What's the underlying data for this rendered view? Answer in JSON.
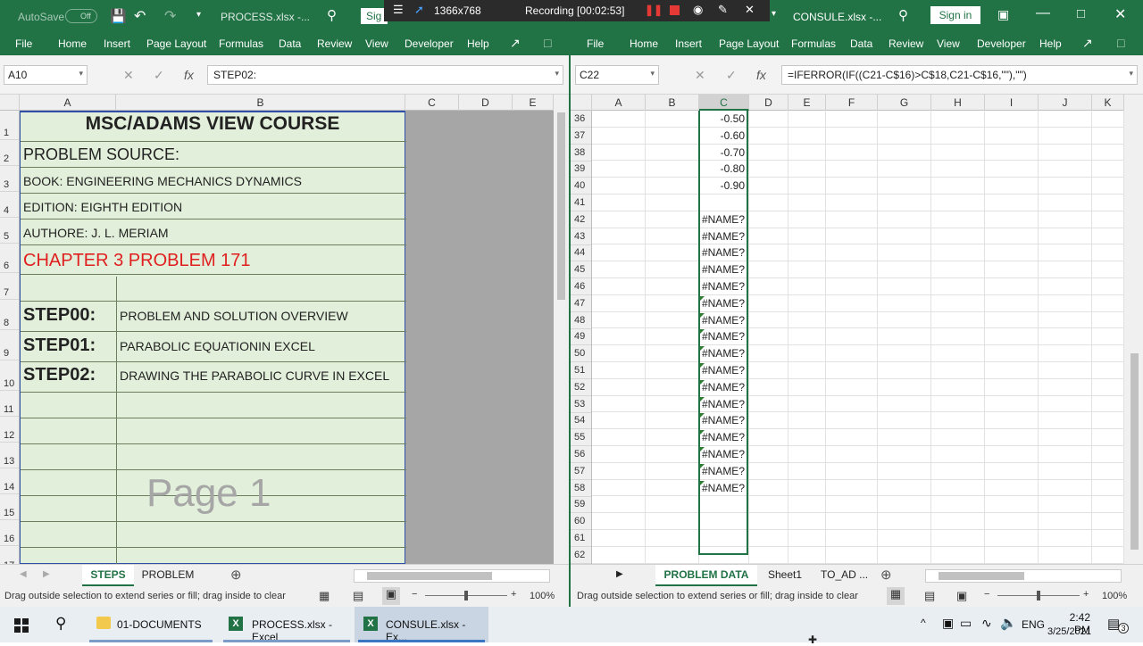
{
  "left": {
    "autosave_label": "AutoSave",
    "autosave_state": "Off",
    "title": "PROCESS.xlsx  -...",
    "signin_label": "Sig",
    "menu": [
      "File",
      "Home",
      "Insert",
      "Page Layout",
      "Formulas",
      "Data",
      "Review",
      "View",
      "Developer",
      "Help"
    ],
    "name_box": "A10",
    "formula": "STEP02:",
    "columns": [
      "A",
      "B",
      "C",
      "D",
      "E"
    ],
    "rows": [
      "1",
      "2",
      "3",
      "4",
      "5",
      "6",
      "7",
      "8",
      "9",
      "10",
      "11",
      "12",
      "13",
      "14",
      "15",
      "16",
      "17"
    ],
    "cells": {
      "title": "MSC/ADAMS VIEW COURSE",
      "source": "PROBLEM SOURCE:",
      "book": "BOOK: ENGINEERING MECHANICS DYNAMICS",
      "edition": "EDITION: EIGHTH EDITION",
      "author": "AUTHORE: J. L. MERIAM",
      "chapter": "CHAPTER 3 PROBLEM 171",
      "step00": "STEP00:",
      "step00_desc": "PROBLEM AND SOLUTION OVERVIEW",
      "step01": "STEP01:",
      "step01_desc": "PARABOLIC EQUATIONIN EXCEL",
      "step02": "STEP02:",
      "step02_desc": "DRAWING THE PARABOLIC CURVE IN EXCEL"
    },
    "watermark": "Page 1",
    "tabs": [
      "STEPS",
      "PROBLEM"
    ],
    "active_tab": "STEPS",
    "status": "Drag outside selection to extend series or fill; drag inside to clear",
    "zoom": "100%"
  },
  "recording": {
    "resolution": "1366x768",
    "label": "Recording [00:02:53]"
  },
  "right": {
    "title": "CONSULE.xlsx  -...",
    "signin_label": "Sign in",
    "menu": [
      "File",
      "Home",
      "Insert",
      "Page Layout",
      "Formulas",
      "Data",
      "Review",
      "View",
      "Developer",
      "Help"
    ],
    "name_box": "C22",
    "formula": "=IFERROR(IF((C21-C$16)>C$18,C21-C$16,\"\"),\"\")",
    "columns": [
      "A",
      "B",
      "C",
      "D",
      "E",
      "F",
      "G",
      "H",
      "I",
      "J",
      "K"
    ],
    "rows": [
      "36",
      "37",
      "38",
      "39",
      "40",
      "41",
      "42",
      "43",
      "44",
      "45",
      "46",
      "47",
      "48",
      "49",
      "50",
      "51",
      "52",
      "53",
      "54",
      "55",
      "56",
      "57",
      "58",
      "59",
      "60",
      "61",
      "62"
    ],
    "values": [
      "-0.50",
      "-0.60",
      "-0.70",
      "-0.80",
      "-0.90"
    ],
    "error_value": "#NAME?",
    "tabs": [
      "PROBLEM DATA",
      "Sheet1",
      "TO_AD ..."
    ],
    "active_tab": "PROBLEM DATA",
    "status": "Drag outside selection to extend series or fill; drag inside to clear",
    "zoom": "100%"
  },
  "taskbar": {
    "items": [
      "01-DOCUMENTS",
      "PROCESS.xlsx - Excel",
      "CONSULE.xlsx - Ex..."
    ],
    "lang": "ENG",
    "time": "2:42 PM",
    "date": "3/25/2021",
    "notif": "3"
  },
  "colors": {
    "excel_green": "#217346",
    "cell_fill": "#e2efda",
    "chapter_red": "#e02020",
    "taskbar": "#e9eef3"
  }
}
